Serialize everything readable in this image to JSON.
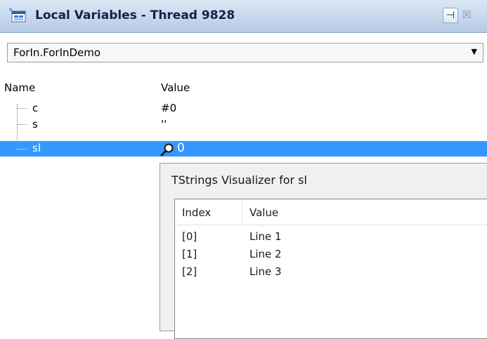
{
  "window": {
    "title": "Local Variables - Thread 9828",
    "icon": "debug-locals-icon",
    "pin_glyph": "ᚒ",
    "close_glyph": "☒"
  },
  "scope": {
    "selected": "ForIn.ForInDemo"
  },
  "columns": {
    "name": "Name",
    "value": "Value"
  },
  "variables": [
    {
      "name": "c",
      "value": "#0"
    },
    {
      "name": "s",
      "value": "''"
    },
    {
      "name": "sl",
      "value": "0",
      "selected": true,
      "icon": "magnifier-icon"
    }
  ],
  "visualizer": {
    "title": "TStrings Visualizer for sl",
    "columns": {
      "index": "Index",
      "value": "Value"
    },
    "rows": [
      {
        "index": "[0]",
        "value": "Line 1"
      },
      {
        "index": "[1]",
        "value": "Line 2"
      },
      {
        "index": "[2]",
        "value": "Line 3"
      }
    ]
  },
  "colors": {
    "selection": "#3399ff",
    "titlebar": "#c6d8ee"
  }
}
